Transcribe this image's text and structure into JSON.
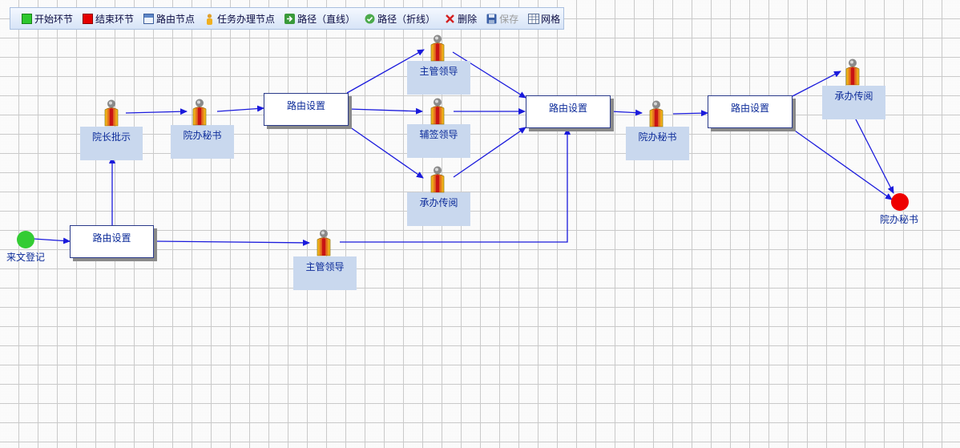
{
  "toolbar": {
    "start": "开始环节",
    "end": "结束环节",
    "route_node": "路由节点",
    "task_node": "任务办理节点",
    "path_straight": "路径（直线）",
    "path_polyline": "路径（折线）",
    "delete": "删除",
    "save": "保存",
    "grid": "网格"
  },
  "colors": {
    "start_green": "#33cc33",
    "end_red": "#ee0000",
    "edge_blue": "#1a1adc",
    "label_bg": "#c9d8ee"
  },
  "nodes": {
    "start": "来文登记",
    "route1": "路由设置",
    "dean": "院长批示",
    "secretary1": "院办秘书",
    "route2": "路由设置",
    "leader_top": "主管领导",
    "cosign": "辅签领导",
    "handle_read1": "承办传阅",
    "route3": "路由设置",
    "leader_bottom": "主管领导",
    "secretary2": "院办秘书",
    "route4": "路由设置",
    "handle_read2": "承办传阅",
    "end": "院办秘书"
  }
}
